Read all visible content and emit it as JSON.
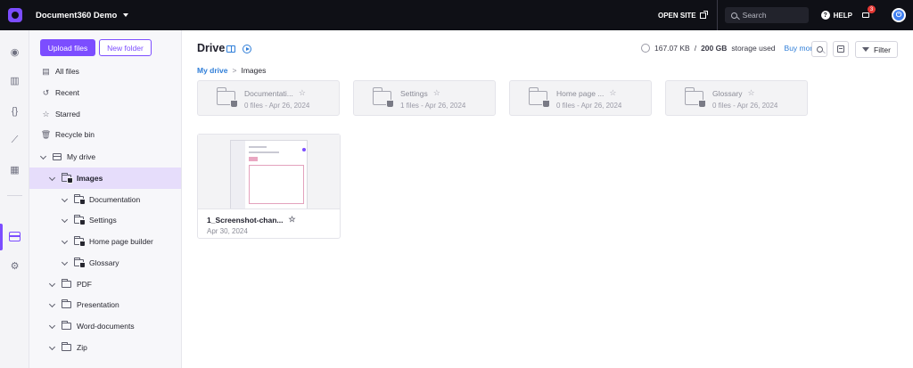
{
  "topbar": {
    "project_name": "Document360 Demo",
    "open_site": "OPEN SITE",
    "search_placeholder": "Search",
    "help": "HELP",
    "notification_count": "3"
  },
  "sidebar": {
    "upload_button": "Upload files",
    "new_folder_button": "New folder",
    "nav": {
      "all_files": "All files",
      "recent": "Recent",
      "starred": "Starred",
      "recycle_bin": "Recycle bin"
    },
    "tree": {
      "my_drive": "My drive",
      "images": "Images",
      "documentation": "Documentation",
      "settings": "Settings",
      "home_page_builder": "Home page builder",
      "glossary": "Glossary",
      "pdf": "PDF",
      "presentation": "Presentation",
      "word_documents": "Word-documents",
      "zip": "Zip"
    }
  },
  "main": {
    "title": "Drive",
    "storage_used": "167.07 KB",
    "storage_total": "200 GB",
    "storage_suffix": "storage used",
    "buy_more": "Buy more",
    "filter": "Filter",
    "breadcrumb": {
      "root": "My drive",
      "separator": ">",
      "current": "Images"
    },
    "folders": [
      {
        "name": "Documentati...",
        "meta": "0 files - Apr 26, 2024"
      },
      {
        "name": "Settings",
        "meta": "1 files - Apr 26, 2024"
      },
      {
        "name": "Home page ...",
        "meta": "0 files - Apr 26, 2024"
      },
      {
        "name": "Glossary",
        "meta": "0 files - Apr 26, 2024"
      }
    ],
    "file": {
      "name": "1_Screenshot-chan...",
      "date": "Apr 30, 2024"
    }
  },
  "colors": {
    "accent": "#7c4dff",
    "topbar": "#0f1016",
    "link": "#2f7ed8",
    "selected_row": "#e6ddfb"
  }
}
